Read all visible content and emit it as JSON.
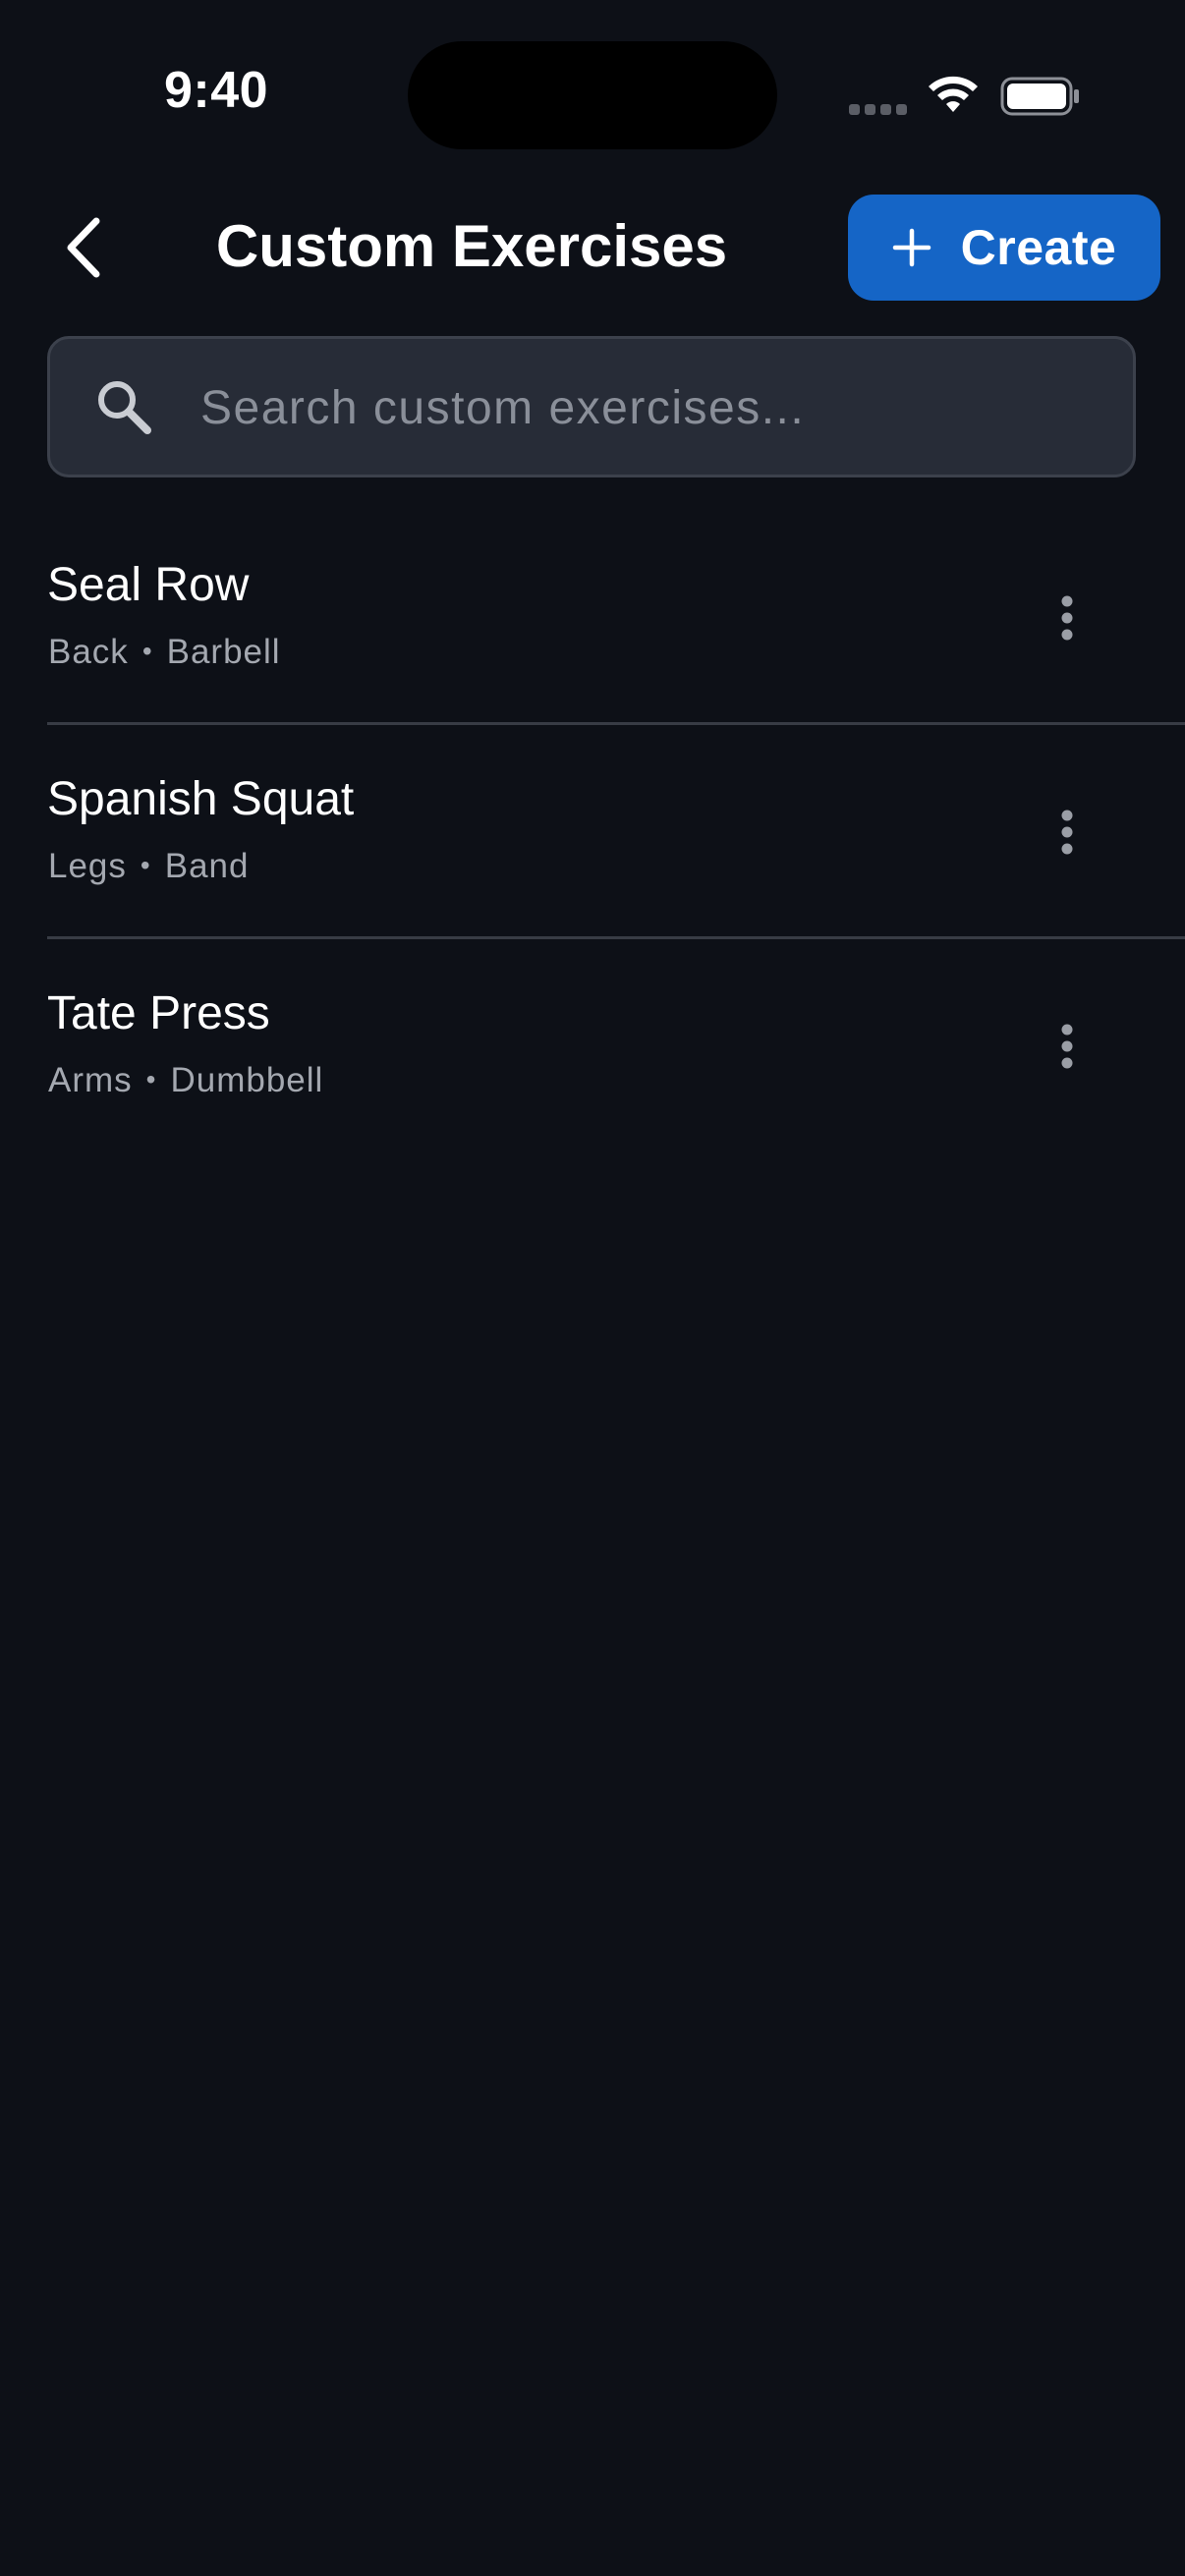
{
  "status_bar": {
    "time": "9:40"
  },
  "header": {
    "title": "Custom Exercises",
    "create_label": "Create"
  },
  "search": {
    "placeholder": "Search custom exercises...",
    "value": ""
  },
  "exercises": [
    {
      "name": "Seal Row",
      "muscle": "Back",
      "separator": "•",
      "equipment": "Barbell"
    },
    {
      "name": "Spanish Squat",
      "muscle": "Legs",
      "separator": "•",
      "equipment": "Band"
    },
    {
      "name": "Tate Press",
      "muscle": "Arms",
      "separator": "•",
      "equipment": "Dumbbell"
    }
  ],
  "colors": {
    "background": "#0d1017",
    "accent": "#1565c6",
    "search_background": "#272c37",
    "secondary_text": "#a4a8b0",
    "divider": "#383c45"
  },
  "icons": {
    "back": "chevron-left-icon",
    "create": "plus-icon",
    "search": "search-icon",
    "more": "more-vertical-icon",
    "wifi": "wifi-icon",
    "battery": "battery-icon",
    "signal": "signal-icon"
  }
}
